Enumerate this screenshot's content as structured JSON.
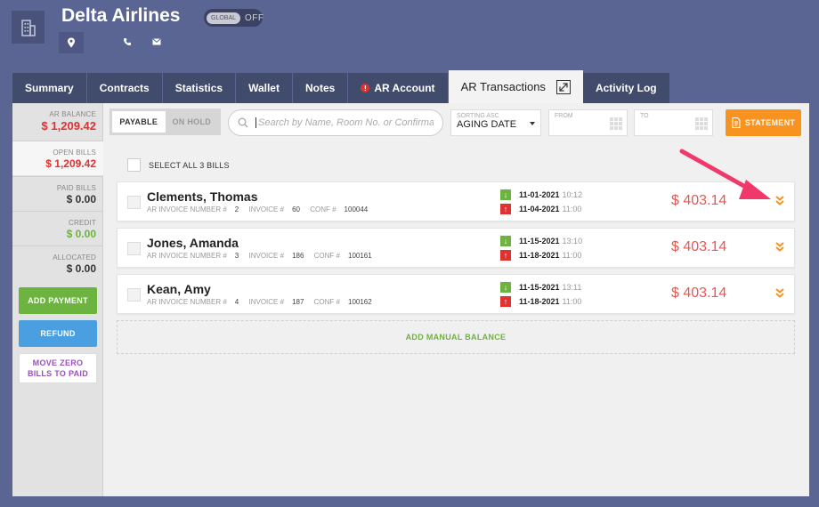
{
  "header": {
    "company_icon": "building-icon",
    "company_name": "Delta Airlines",
    "global_toggle": {
      "label": "GLOBAL",
      "state": "OFF"
    },
    "icons": [
      "location-icon",
      "phone-icon",
      "mail-icon"
    ]
  },
  "tabs": [
    {
      "label": "Summary",
      "active": false
    },
    {
      "label": "Contracts",
      "active": false
    },
    {
      "label": "Statistics",
      "active": false
    },
    {
      "label": "Wallet",
      "active": false
    },
    {
      "label": "Notes",
      "active": false
    },
    {
      "label": "AR Account",
      "active": false,
      "alert": "!"
    },
    {
      "label": "AR Transactions",
      "active": true
    },
    {
      "label": "Activity Log",
      "active": false
    }
  ],
  "summary": {
    "ar_balance": {
      "label": "AR BALANCE",
      "value": "$ 1,209.42"
    },
    "open_bills": {
      "label": "OPEN BILLS",
      "value": "$ 1,209.42"
    },
    "paid_bills": {
      "label": "PAID BILLS",
      "value": "$ 0.00"
    },
    "credit": {
      "label": "CREDIT",
      "value": "$ 0.00"
    },
    "allocated": {
      "label": "ALLOCATED",
      "value": "$ 0.00"
    }
  },
  "actions": {
    "add_payment": "ADD PAYMENT",
    "refund": "REFUND",
    "move_zero": "MOVE ZERO BILLS TO PAID"
  },
  "toolbar": {
    "seg_payable": "PAYABLE",
    "seg_on_hold": "ON HOLD",
    "search_placeholder": "Search by Name, Room No. or Confirmation",
    "sort_label": "SORTING ASC",
    "sort_value": "AGING DATE",
    "from_label": "FROM",
    "to_label": "TO",
    "statement": "STATEMENT"
  },
  "select_all": "SELECT ALL 3 BILLS",
  "bills": [
    {
      "name": "Clements, Thomas",
      "ar_invoice_label": "AR INVOICE NUMBER #",
      "ar_invoice": "2",
      "invoice_label": "INVOICE #",
      "invoice": "60",
      "conf_label": "CONF #",
      "conf": "100044",
      "in_date": "11-01-2021",
      "in_time": "10:12",
      "out_date": "11-04-2021",
      "out_time": "11:00",
      "amount": "$ 403.14"
    },
    {
      "name": "Jones, Amanda",
      "ar_invoice_label": "AR INVOICE NUMBER #",
      "ar_invoice": "3",
      "invoice_label": "INVOICE #",
      "invoice": "186",
      "conf_label": "CONF #",
      "conf": "100161",
      "in_date": "11-15-2021",
      "in_time": "13:10",
      "out_date": "11-18-2021",
      "out_time": "11:00",
      "amount": "$ 403.14"
    },
    {
      "name": "Kean, Amy",
      "ar_invoice_label": "AR INVOICE NUMBER #",
      "ar_invoice": "4",
      "invoice_label": "INVOICE #",
      "invoice": "187",
      "conf_label": "CONF #",
      "conf": "100162",
      "in_date": "11-15-2021",
      "in_time": "13:11",
      "out_date": "11-18-2021",
      "out_time": "11:00",
      "amount": "$ 403.14"
    }
  ],
  "add_manual_balance": "ADD MANUAL BALANCE",
  "colors": {
    "background": "#5a6593",
    "accent_orange": "#f7931e",
    "green": "#6cb33f",
    "blue": "#4a9fe1",
    "red": "#e03131",
    "purple": "#9c4ec0",
    "annotation_arrow": "#f0386b"
  }
}
